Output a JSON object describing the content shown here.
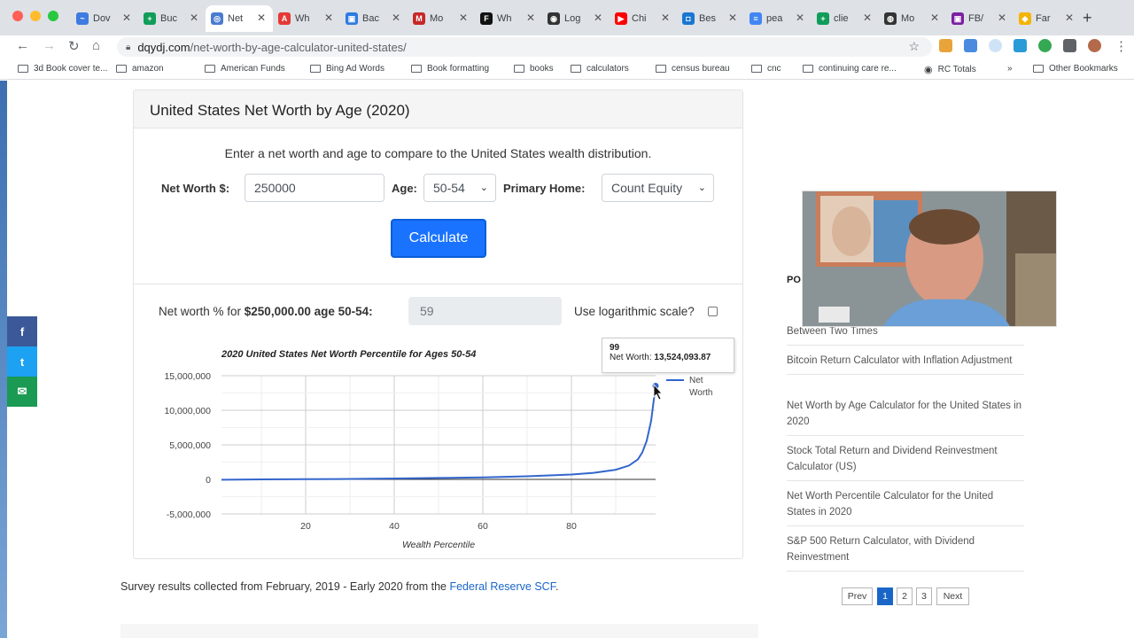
{
  "browser": {
    "tabs": [
      {
        "label": "Dov",
        "color": "#3d7be0",
        "glyph": "~"
      },
      {
        "label": "Buc",
        "color": "#0f9d58",
        "glyph": "+"
      },
      {
        "label": "Net",
        "color": "#4a7bd0",
        "glyph": "◎",
        "active": true
      },
      {
        "label": "Wh",
        "color": "#e53935",
        "glyph": "A"
      },
      {
        "label": "Bac",
        "color": "#2d7be0",
        "glyph": "▣"
      },
      {
        "label": "Mo",
        "color": "#c62828",
        "glyph": "M"
      },
      {
        "label": "Wh",
        "color": "#111111",
        "glyph": "F"
      },
      {
        "label": "Log",
        "color": "#333333",
        "glyph": "◉"
      },
      {
        "label": "Chi",
        "color": "#ff0000",
        "glyph": "▶"
      },
      {
        "label": "Bes",
        "color": "#1976d2",
        "glyph": "◘"
      },
      {
        "label": "pea",
        "color": "#4285f4",
        "glyph": "≡"
      },
      {
        "label": "clie",
        "color": "#0f9d58",
        "glyph": "+"
      },
      {
        "label": "Mo",
        "color": "#333333",
        "glyph": "◍"
      },
      {
        "label": "FB/",
        "color": "#7b1fa2",
        "glyph": "▣"
      },
      {
        "label": "Far",
        "color": "#f4b400",
        "glyph": "◆"
      }
    ],
    "url_host": "dqydj.com",
    "url_path": "/net-worth-by-age-calculator-united-states/",
    "bookmarks": [
      "3d Book cover te...",
      "amazon",
      "American Funds",
      "Bing Ad Words",
      "Book formatting",
      "books",
      "calculators",
      "census bureau",
      "cnc",
      "continuing care re...",
      "RC Totals",
      "»",
      "Other Bookmarks"
    ]
  },
  "calculator": {
    "title": "United States Net Worth by Age (2020)",
    "instructions": "Enter a net worth and age to compare to the United States wealth distribution.",
    "net_worth_label": "Net Worth $:",
    "net_worth_value": "250000",
    "age_label": "Age:",
    "age_value": "50-54",
    "home_label": "Primary Home:",
    "home_value": "Count Equity",
    "calculate_label": "Calculate",
    "result_prefix": "Net worth % for ",
    "result_bold": "$250,000.00 age 50-54:",
    "result_value": "59",
    "log_label": "Use logarithmic scale?"
  },
  "tooltip": {
    "percentile": "99",
    "label": "Net Worth:",
    "value": "13,524,093.87"
  },
  "chart_data": {
    "type": "line",
    "title": "2020 United States Net Worth Percentile for Ages 50-54",
    "xlabel": "Wealth Percentile",
    "ylabel": "",
    "xlim": [
      1,
      99
    ],
    "ylim": [
      -5000000,
      15000000
    ],
    "x_ticks": [
      20,
      40,
      60,
      80
    ],
    "y_ticks": [
      -5000000,
      0,
      5000000,
      10000000,
      15000000
    ],
    "y_tick_labels": [
      "-5,000,000",
      "0",
      "5,000,000",
      "10,000,000",
      "15,000,000"
    ],
    "x_tick_labels": [
      "20",
      "40",
      "60",
      "80"
    ],
    "legend": "right",
    "grid": true,
    "line_color": "#3366cc",
    "series": [
      {
        "name": "Net Worth",
        "x": [
          1,
          10,
          20,
          30,
          40,
          50,
          60,
          70,
          80,
          85,
          90,
          93,
          95,
          96,
          97,
          98,
          99
        ],
        "values": [
          -50000,
          5000,
          30000,
          70000,
          130000,
          200000,
          300000,
          450000,
          700000,
          950000,
          1400000,
          2000000,
          2900000,
          3900000,
          5600000,
          8500000,
          13524093.87
        ]
      }
    ]
  },
  "survey": {
    "text": "Survey results collected from February, 2019 - Early 2020 from the ",
    "link": "Federal Reserve SCF",
    "end": "."
  },
  "sidebar": {
    "heading": "PO",
    "items": [
      "Between Two Times",
      "Bitcoin Return Calculator with Inflation Adjustment",
      "Net Worth by Age Calculator for the United States in 2020",
      "Stock Total Return and Dividend Reinvestment Calculator (US)",
      "Net Worth Percentile Calculator for the United States in 2020",
      "S&P 500 Return Calculator, with Dividend Reinvestment"
    ],
    "pagination": [
      "Prev",
      "1",
      "2",
      "3",
      "Next"
    ]
  },
  "social": [
    {
      "icon": "f",
      "color": "#3b5998"
    },
    {
      "icon": "t",
      "color": "#1da1f2"
    },
    {
      "icon": "✉",
      "color": "#1a9a52"
    }
  ],
  "colors": {
    "accent": "#1a73ff",
    "link": "#1a66c7"
  }
}
